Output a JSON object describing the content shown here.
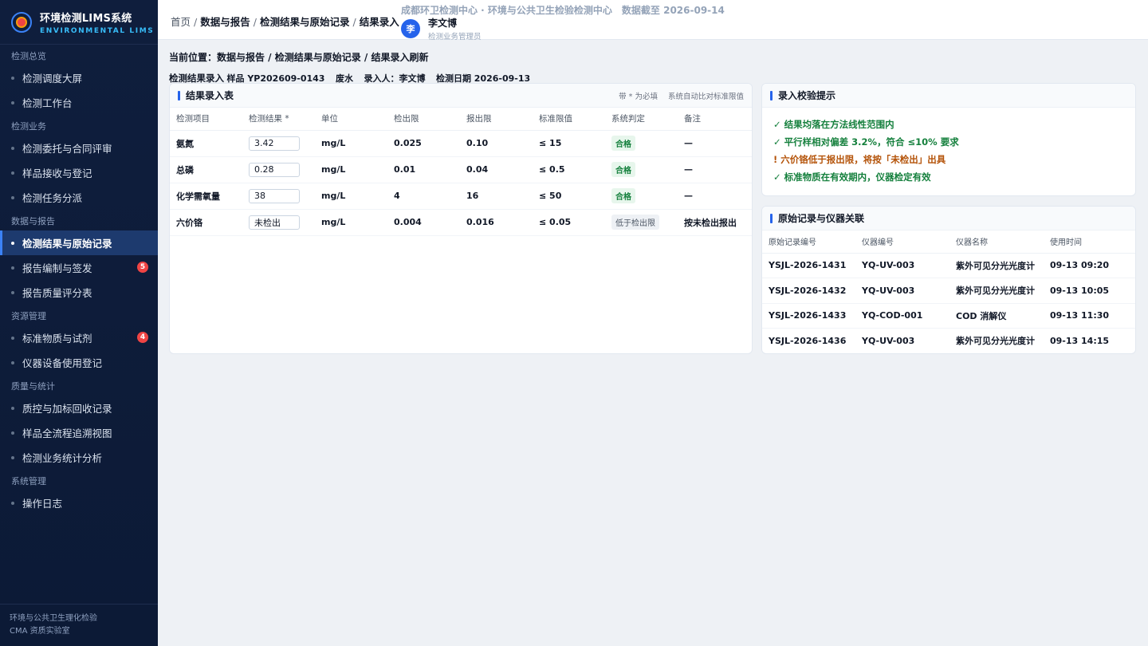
{
  "brand": {
    "title": "环境检测LIMS系统",
    "subtitle": "ENVIRONMENTAL LIMS"
  },
  "sidebar": {
    "groups": [
      {
        "label": "检测总览",
        "items": [
          {
            "label": "检测调度大屏"
          },
          {
            "label": "检测工作台"
          }
        ]
      },
      {
        "label": "检测业务",
        "items": [
          {
            "label": "检测委托与合同评审"
          },
          {
            "label": "样品接收与登记"
          },
          {
            "label": "检测任务分派"
          }
        ]
      },
      {
        "label": "数据与报告",
        "items": [
          {
            "label": "检测结果与原始记录",
            "active": true
          },
          {
            "label": "报告编制与签发",
            "badge": "5"
          },
          {
            "label": "报告质量评分表"
          }
        ]
      },
      {
        "label": "资源管理",
        "items": [
          {
            "label": "标准物质与试剂",
            "badge": "4"
          },
          {
            "label": "仪器设备使用登记"
          }
        ]
      },
      {
        "label": "质量与统计",
        "items": [
          {
            "label": "质控与加标回收记录"
          },
          {
            "label": "样品全流程追溯视图"
          },
          {
            "label": "检测业务统计分析"
          }
        ]
      },
      {
        "label": "系统管理",
        "items": [
          {
            "label": "操作日志"
          }
        ]
      }
    ],
    "footer": {
      "line1": "环境与公共卫生理化检验",
      "line2": "CMA 资质实验室"
    }
  },
  "topbar": {
    "breadcrumb": {
      "home": "首页",
      "sep": "/",
      "c1": "数据与报告",
      "c2": "检测结果与原始记录",
      "c3": "结果录入"
    },
    "org": "成都环卫检测中心 · 环境与公共卫生检验检测中心",
    "data_date": "数据截至 2026-09-14",
    "user": {
      "avatar": "李",
      "name": "李文博",
      "role": "检测业务管理员"
    }
  },
  "location": "当前位置：数据与报告 / 检测结果与原始记录 / 结果录入刷新",
  "subhead": {
    "title": "检测结果录入",
    "sample": "样品 YP202609-0143",
    "matrix": "废水",
    "recorder": "录入人：李文博",
    "date": "检测日期 2026-09-13"
  },
  "entry_card": {
    "title": "结果录入表",
    "note_required": "带 * 为必填",
    "note_auto": "系统自动比对标准限值",
    "columns": [
      "检测项目",
      "检测结果 *",
      "单位",
      "检出限",
      "报出限",
      "标准限值",
      "系统判定",
      "备注"
    ],
    "rows": [
      {
        "item": "氨氮",
        "result": "3.42",
        "unit": "mg/L",
        "mdl": "0.025",
        "rl": "0.10",
        "limit": "≤ 15",
        "judge": "合格",
        "judge_type": "ok",
        "note": "—"
      },
      {
        "item": "总磷",
        "result": "0.28",
        "unit": "mg/L",
        "mdl": "0.01",
        "rl": "0.04",
        "limit": "≤ 0.5",
        "judge": "合格",
        "judge_type": "ok",
        "note": "—"
      },
      {
        "item": "化学需氧量",
        "result": "38",
        "unit": "mg/L",
        "mdl": "4",
        "rl": "16",
        "limit": "≤ 50",
        "judge": "合格",
        "judge_type": "ok",
        "note": "—"
      },
      {
        "item": "六价铬",
        "result": "未检出",
        "unit": "mg/L",
        "mdl": "0.004",
        "rl": "0.016",
        "limit": "≤ 0.05",
        "judge": "低于检出限",
        "judge_type": "low",
        "note": "按未检出报出"
      }
    ]
  },
  "tips_card": {
    "title": "录入校验提示",
    "tips": [
      {
        "text": "✓ 结果均落在方法线性范围内",
        "type": "ok"
      },
      {
        "text": "✓ 平行样相对偏差 3.2%，符合 ≤10% 要求",
        "type": "ok"
      },
      {
        "text": "! 六价铬低于报出限，将按「未检出」出具",
        "type": "warn"
      },
      {
        "text": "✓ 标准物质在有效期内，仪器检定有效",
        "type": "ok"
      }
    ]
  },
  "records_card": {
    "title": "原始记录与仪器关联",
    "columns": [
      "原始记录编号",
      "仪器编号",
      "仪器名称",
      "使用时间"
    ],
    "rows": [
      [
        "YSJL-2026-1431",
        "YQ-UV-003",
        "紫外可见分光光度计",
        "09-13 09:20"
      ],
      [
        "YSJL-2026-1432",
        "YQ-UV-003",
        "紫外可见分光光度计",
        "09-13 10:05"
      ],
      [
        "YSJL-2026-1433",
        "YQ-COD-001",
        "COD 消解仪",
        "09-13 11:30"
      ],
      [
        "YSJL-2026-1436",
        "YQ-UV-003",
        "紫外可见分光光度计",
        "09-13 14:15"
      ]
    ]
  }
}
